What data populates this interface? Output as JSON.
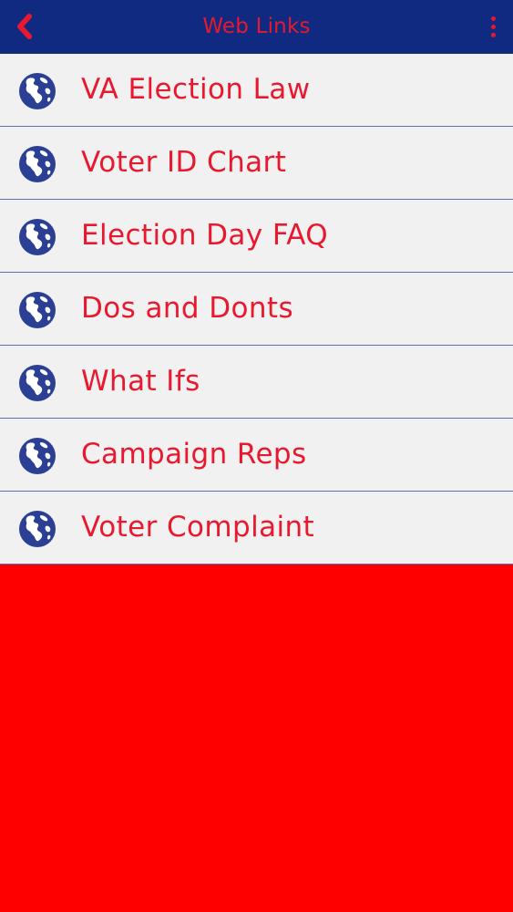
{
  "header": {
    "title": "Web Links",
    "back_icon": "chevron-left-icon",
    "menu_icon": "more-vertical-icon"
  },
  "links": [
    {
      "label": "VA Election Law",
      "icon": "globe-icon"
    },
    {
      "label": "Voter ID Chart",
      "icon": "globe-icon"
    },
    {
      "label": "Election Day FAQ",
      "icon": "globe-icon"
    },
    {
      "label": "Dos and Donts",
      "icon": "globe-icon"
    },
    {
      "label": "What Ifs",
      "icon": "globe-icon"
    },
    {
      "label": "Campaign Reps",
      "icon": "globe-icon"
    },
    {
      "label": "Voter Complaint",
      "icon": "globe-icon"
    }
  ],
  "colors": {
    "header_bg": "#0f2a80",
    "accent": "#e8192f",
    "row_bg": "#f2f1f1",
    "divider": "#5a6fb4",
    "page_bg": "#ff0000",
    "globe": "#2b3f95"
  }
}
